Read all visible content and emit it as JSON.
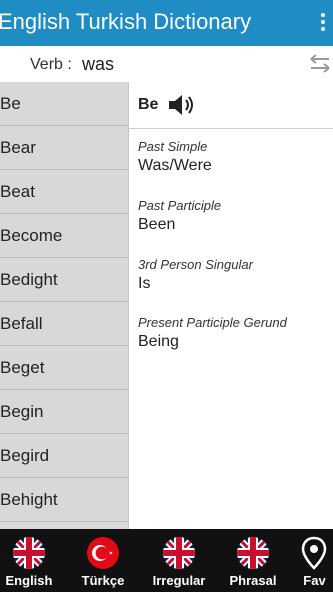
{
  "app": {
    "title": "English Turkish Dictionary"
  },
  "search": {
    "label": "Verb :",
    "value": "was"
  },
  "word_list": [
    "Be",
    "Bear",
    "Beat",
    "Become",
    "Bedight",
    "Befall",
    "Beget",
    "Begin",
    "Begird",
    "Behight"
  ],
  "detail": {
    "word": "Be",
    "forms": [
      {
        "label": "Past Simple",
        "value": "Was/Were"
      },
      {
        "label": "Past Participle",
        "value": "Been"
      },
      {
        "label": "3rd Person Singular",
        "value": "Is"
      },
      {
        "label": "Present Participle Gerund",
        "value": "Being"
      }
    ]
  },
  "tabs": [
    {
      "label": "English",
      "icon": "uk-flag-icon"
    },
    {
      "label": "Türkçe",
      "icon": "turkey-flag-icon"
    },
    {
      "label": "Irregular",
      "icon": "uk-flag-icon"
    },
    {
      "label": "Phrasal",
      "icon": "uk-flag-icon"
    },
    {
      "label": "Fav",
      "icon": "location-pin-icon"
    }
  ],
  "colors": {
    "appbar": "#1f8cc4",
    "list_bg": "#d8d8d8",
    "tabbar": "#111111",
    "turkey_red": "#e30a17",
    "uk_blue": "#012169",
    "uk_red": "#c8102e"
  }
}
